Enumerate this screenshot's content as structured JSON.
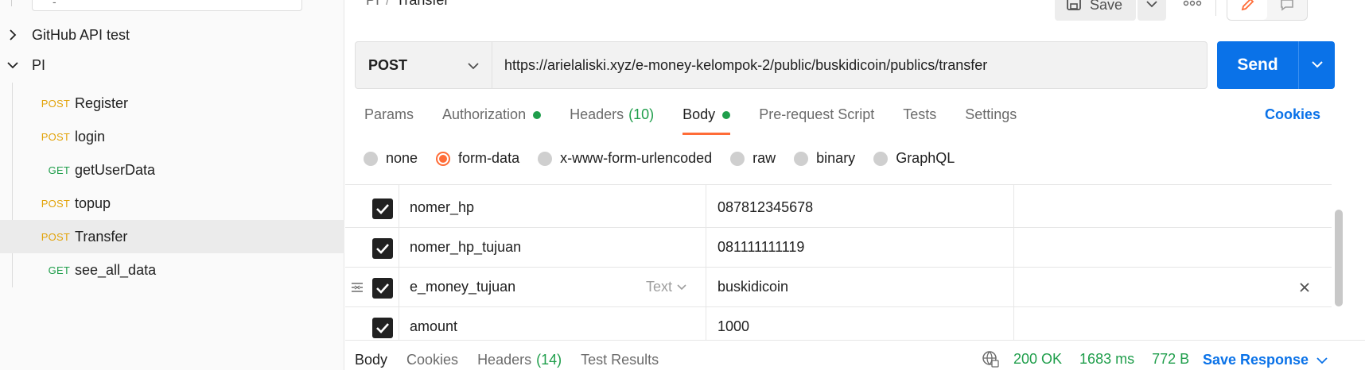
{
  "sidebar": {
    "search_value": "-",
    "collections": [
      {
        "label": "GitHub API test",
        "expanded": false
      },
      {
        "label": "PI",
        "expanded": true
      }
    ],
    "requests": [
      {
        "method": "POST",
        "name": "Register"
      },
      {
        "method": "POST",
        "name": "login"
      },
      {
        "method": "GET",
        "name": "getUserData"
      },
      {
        "method": "POST",
        "name": "topup"
      },
      {
        "method": "POST",
        "name": "Transfer",
        "active": true
      },
      {
        "method": "GET",
        "name": "see_all_data"
      }
    ]
  },
  "header": {
    "breadcrumb_parent": "PI",
    "breadcrumb_sep": "/",
    "breadcrumb_current": "Transfer",
    "save_label": "Save"
  },
  "request": {
    "method": "POST",
    "url": "https://arielaliski.xyz/e-money-kelompok-2/public/buskidicoin/publics/transfer",
    "send_label": "Send"
  },
  "tabs": [
    {
      "label": "Params"
    },
    {
      "label": "Authorization",
      "dot": true
    },
    {
      "label": "Headers",
      "count": "(10)"
    },
    {
      "label": "Body",
      "dot": true,
      "active": true
    },
    {
      "label": "Pre-request Script"
    },
    {
      "label": "Tests"
    },
    {
      "label": "Settings"
    }
  ],
  "cookies_label": "Cookies",
  "body_modes": [
    {
      "label": "none"
    },
    {
      "label": "form-data",
      "selected": true
    },
    {
      "label": "x-www-form-urlencoded"
    },
    {
      "label": "raw"
    },
    {
      "label": "binary"
    },
    {
      "label": "GraphQL"
    }
  ],
  "form_rows": [
    {
      "key": "nomer_hp",
      "value": "087812345678",
      "checked": true
    },
    {
      "key": "nomer_hp_tujuan",
      "value": "081111111119",
      "checked": true
    },
    {
      "key": "e_money_tujuan",
      "type": "Text",
      "value": "buskidicoin",
      "checked": true,
      "hovered": true
    },
    {
      "key": "amount",
      "value": "1000",
      "checked": true
    }
  ],
  "response": {
    "tabs": [
      {
        "label": "Body",
        "active": true
      },
      {
        "label": "Cookies"
      },
      {
        "label": "Headers",
        "count": "(14)"
      },
      {
        "label": "Test Results"
      }
    ],
    "status": "200 OK",
    "time": "1683 ms",
    "size": "772 B",
    "save_label": "Save Response"
  },
  "colors": {
    "accent_blue": "#0a72e8",
    "post_method": "#e2a30a",
    "get_method": "#1f9e4b",
    "active_tab_underline": "#ff6c37",
    "status_green": "#1f9e4b"
  },
  "icons": {
    "collapse": "chevron-right-icon",
    "expand": "chevron-down-icon",
    "save": "save-icon",
    "more": "more-horizontal-icon",
    "edit": "pencil-icon",
    "comment": "comment-icon",
    "drag": "drag-handle-icon",
    "delete": "close-icon",
    "network": "globe-icon"
  }
}
